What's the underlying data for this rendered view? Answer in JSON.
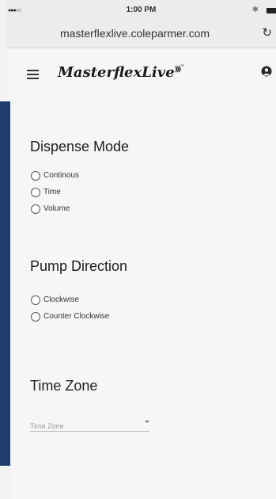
{
  "status_bar": {
    "signal": "●●●○○",
    "time": "1:00 PM",
    "bluetooth": "bluetooth-icon",
    "battery": "battery-icon"
  },
  "browser": {
    "url": "masterflexlive.coleparmer.com",
    "reload_icon": "reload-icon"
  },
  "header": {
    "menu_icon": "hamburger-menu-icon",
    "logo_text": "MasterflexLive",
    "account_icon": "account-icon"
  },
  "dispense_mode": {
    "title": "Dispense Mode",
    "options": [
      "Continous",
      "Time",
      "Volume"
    ]
  },
  "pump_direction": {
    "title": "Pump Direction",
    "options": [
      "Clockwise",
      "Counter Clockwise"
    ]
  },
  "time_zone": {
    "title": "Time Zone",
    "placeholder": "Time Zone"
  },
  "colors": {
    "brand_blue": "#1f3d6c"
  }
}
